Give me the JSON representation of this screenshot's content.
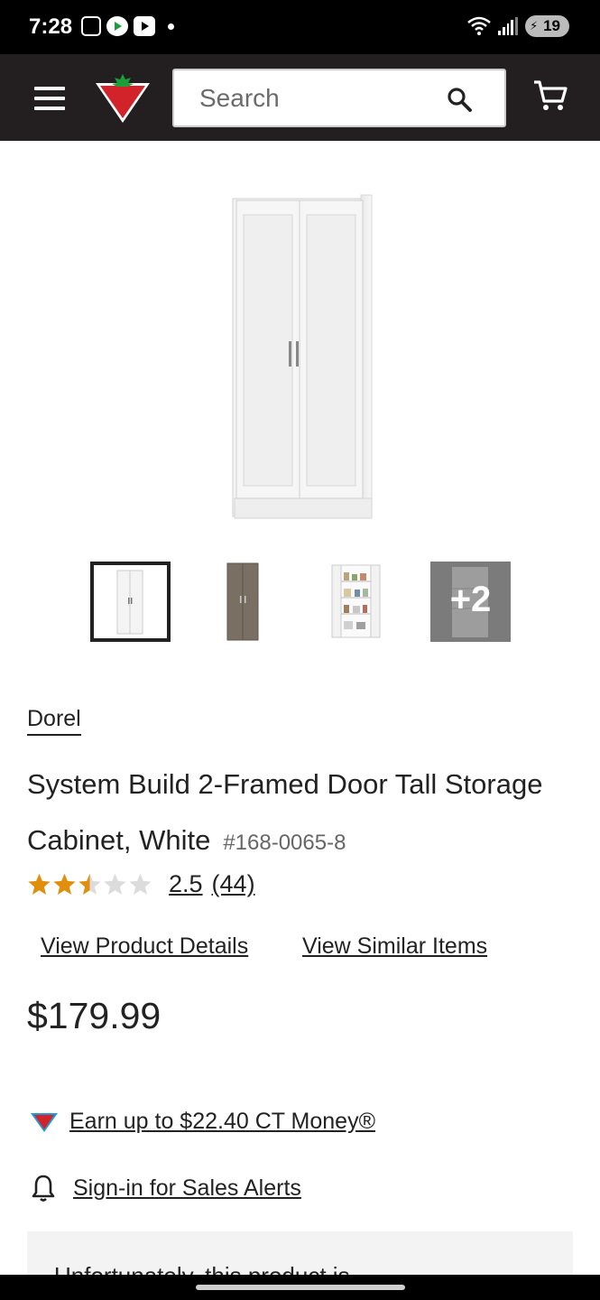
{
  "status_bar": {
    "time": "7:28",
    "battery": "19",
    "icons": [
      "screen-record-icon",
      "play-store-icon",
      "youtube-icon",
      "notification-dot-icon",
      "wifi-icon",
      "signal-icon",
      "battery-icon"
    ]
  },
  "header": {
    "menu_icon": "hamburger-menu-icon",
    "logo": "canadian-tire-logo",
    "search": {
      "placeholder": "Search",
      "value": ""
    },
    "search_icon": "search-icon",
    "cart_icon": "cart-icon",
    "colors": {
      "background": "#231f20",
      "brand_red": "#d2232a"
    }
  },
  "gallery": {
    "main_image": "white-two-door-storage-cabinet",
    "thumbnails": [
      {
        "image": "white-cabinet-thumbnail",
        "selected": true
      },
      {
        "image": "brown-cabinet-thumbnail",
        "selected": false
      },
      {
        "image": "open-cabinet-with-shelves-thumbnail",
        "selected": false
      },
      {
        "image": "more-images-thumbnail",
        "selected": false,
        "label": "+2"
      }
    ]
  },
  "product": {
    "brand": "Dorel",
    "title": "System Build 2-Framed Door Tall Storage Cabinet, White",
    "sku": "#168-0065-8",
    "rating": {
      "value": "2.5",
      "count": "(44)",
      "stars_filled": 2.5,
      "stars_total": 5,
      "star_color": "#e08e0b"
    },
    "links": {
      "details": "View Product Details",
      "similar": "View Similar Items"
    },
    "price": "$179.99",
    "ct_money": "Earn up to $22.40 CT Money®",
    "sales_alert": "Sign-in for Sales Alerts",
    "notice": "Unfortunately, this product is"
  }
}
